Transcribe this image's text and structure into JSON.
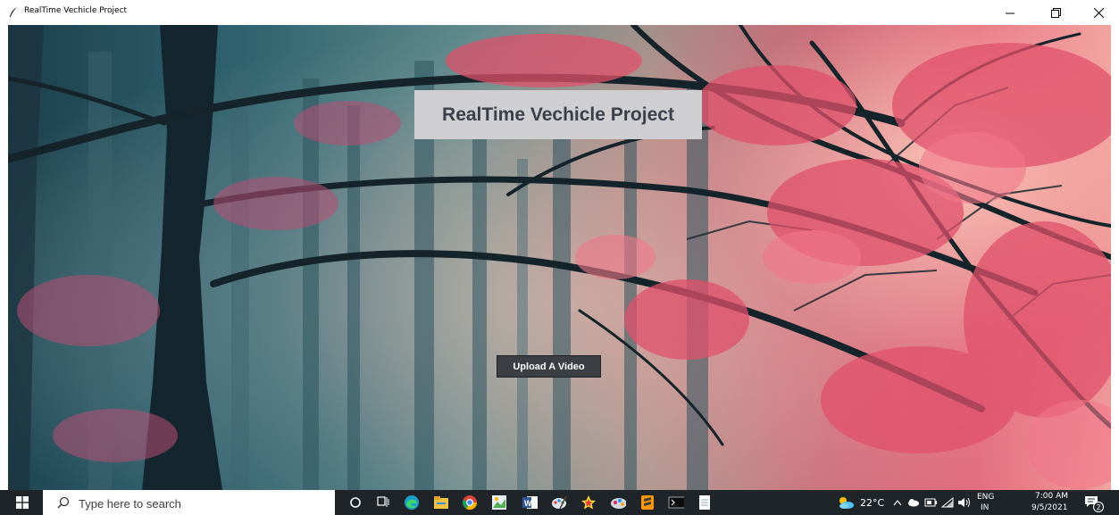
{
  "window": {
    "title": "RealTime Vechicle Project",
    "minimize_glyph": "—",
    "restore_glyph": "❐",
    "close_glyph": "✕"
  },
  "app": {
    "banner_title": "RealTime Vechicle Project",
    "upload_button_label": "Upload A Video"
  },
  "taskbar": {
    "search_placeholder": "Type here to search",
    "pinned_apps": [
      "cortana-icon",
      "task-view-icon",
      "edge-icon",
      "file-explorer-icon",
      "chrome-icon",
      "image-editor-icon",
      "word-icon",
      "paint-icon",
      "star-app-icon",
      "paint-3d-icon",
      "sublime-text-icon",
      "terminal-icon",
      "notepad-icon"
    ],
    "tray": {
      "weather": "22°C",
      "language_top": "ENG",
      "language_bottom": "IN",
      "time": "7:00 AM",
      "date": "9/5/2021",
      "notification_count": "2"
    }
  },
  "colors": {
    "banner_bg": "#cfcfd1",
    "banner_text": "#3a3f4a",
    "button_bg": "#3b3f44",
    "taskbar_bg": "#1f2428"
  }
}
